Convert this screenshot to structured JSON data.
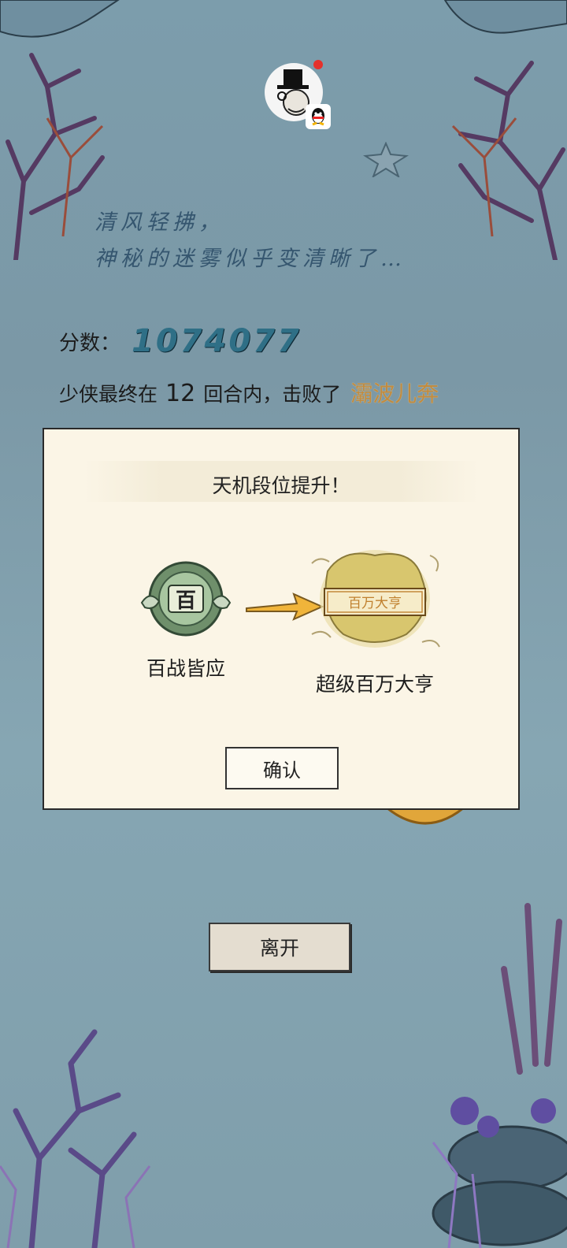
{
  "header": {
    "avatar_icon": "player-avatar-icon",
    "badge_icon": "qq-icon",
    "notification_color": "#e5312b"
  },
  "hint": {
    "line1": "清风轻拂，",
    "line2": "神秘的迷雾似乎变清晰了…"
  },
  "result": {
    "score_label": "分数：",
    "score_value": "1074077",
    "defeat_prefix": "少侠最终在",
    "rounds": "12",
    "defeat_mid": "回合内，击败了",
    "boss_name": "灞波儿奔"
  },
  "dialog": {
    "title": "天机段位提升！",
    "from_rank": {
      "name": "百战皆应",
      "emblem_char": "百"
    },
    "to_rank": {
      "name": "超级百万大亨",
      "emblem_text": "百万大亨"
    },
    "confirm_label": "确认"
  },
  "footer": {
    "leave_label": "离开"
  },
  "colors": {
    "score": "#2f6f86",
    "boss": "#c08b40",
    "dialog_bg": "#fbf5e6"
  }
}
